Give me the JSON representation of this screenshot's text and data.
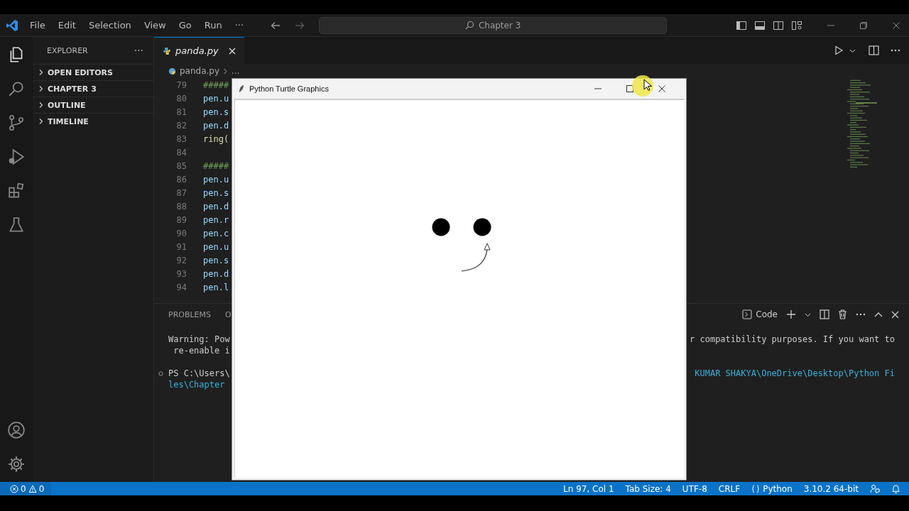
{
  "menu": [
    "File",
    "Edit",
    "Selection",
    "View",
    "Go",
    "Run",
    "···"
  ],
  "command_center": {
    "value": "Chapter 3"
  },
  "sidebar": {
    "title": "EXPLORER",
    "more": "···",
    "sections": [
      {
        "label": "OPEN EDITORS",
        "expanded": false
      },
      {
        "label": "CHAPTER 3",
        "expanded": false
      },
      {
        "label": "OUTLINE",
        "expanded": false
      },
      {
        "label": "TIMELINE",
        "expanded": false
      }
    ]
  },
  "editor": {
    "tabs": [
      {
        "label": "panda.py",
        "selected": true
      }
    ],
    "breadcrumb": [
      "panda.py",
      "..."
    ],
    "lines": [
      {
        "number": "79",
        "text": "#####",
        "kind": "comment"
      },
      {
        "number": "80",
        "text": "pen.u",
        "kind": "code"
      },
      {
        "number": "81",
        "text": "pen.s",
        "kind": "code"
      },
      {
        "number": "82",
        "text": "pen.d",
        "kind": "code"
      },
      {
        "number": "83",
        "text": "ring(",
        "kind": "call"
      },
      {
        "number": "84"
      },
      {
        "number": "85",
        "text": "#####",
        "kind": "comment"
      },
      {
        "number": "86",
        "text": "pen.u",
        "kind": "code"
      },
      {
        "number": "87",
        "text": "pen.s",
        "kind": "code"
      },
      {
        "number": "88",
        "text": "pen.d",
        "kind": "code"
      },
      {
        "number": "89",
        "text": "pen.r",
        "kind": "code"
      },
      {
        "number": "90",
        "text": "pen.c",
        "kind": "code"
      },
      {
        "number": "91",
        "text": "pen.u",
        "kind": "code"
      },
      {
        "number": "92",
        "text": "pen.s",
        "kind": "code"
      },
      {
        "number": "93",
        "text": "pen.d",
        "kind": "code"
      },
      {
        "number": "94",
        "text": "pen.l",
        "kind": "code"
      }
    ]
  },
  "panel": {
    "tabs": [
      {
        "label": "PROBLEMS",
        "selected": false
      },
      {
        "label": "O",
        "selected": false
      }
    ],
    "terminal_name": "Code",
    "lines": [
      {
        "kind": "text",
        "left": "Warning: Pow",
        "right": "r compatibility purposes. If you want to"
      },
      {
        "kind": "text",
        "left": " re-enable i"
      },
      {
        "kind": "blank"
      },
      {
        "kind": "prompt",
        "left": "PS C:\\Users\\",
        "right": "KUMAR SHAKYA\\OneDrive\\Desktop\\Python Fi"
      },
      {
        "kind": "path",
        "left": "les\\Chapter"
      }
    ]
  },
  "turtle_window": {
    "title": "Python Turtle Graphics"
  },
  "status_bar": {
    "errors": "0",
    "warnings": "0",
    "items": [
      {
        "kind": "text",
        "label": "Ln 97, Col 1"
      },
      {
        "kind": "text",
        "label": "Tab Size: 4"
      },
      {
        "kind": "text",
        "label": "UTF-8"
      },
      {
        "kind": "text",
        "label": "CRLF"
      },
      {
        "kind": "language",
        "label": "Python"
      },
      {
        "kind": "text",
        "label": "3.10.2 64-bit"
      }
    ]
  }
}
